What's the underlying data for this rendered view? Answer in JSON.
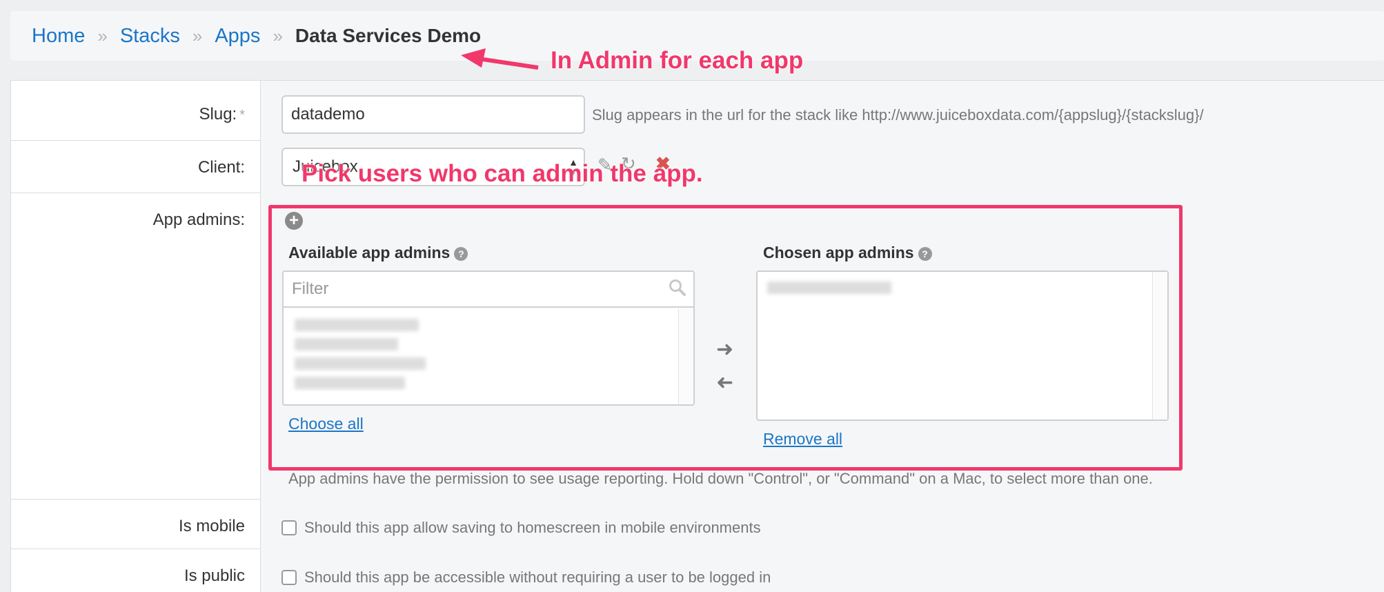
{
  "breadcrumb": {
    "items": [
      "Home",
      "Stacks",
      "Apps"
    ],
    "separator": "»",
    "current": "Data Services Demo"
  },
  "annotations": {
    "admin_note": "In Admin for each app",
    "pick_note": "Pick users who can admin the app."
  },
  "form": {
    "slug": {
      "label": "Slug:",
      "required_mark": "*",
      "value": "datademo",
      "help": "Slug appears in the url for the stack like http://www.juiceboxdata.com/{appslug}/{stackslug}/"
    },
    "client": {
      "label": "Client:",
      "value": "Juicebox"
    },
    "app_admins": {
      "label": "App admins:",
      "available_title": "Available app admins",
      "filter_placeholder": "Filter",
      "choose_all": "Choose all",
      "chosen_title": "Chosen app admins",
      "remove_all": "Remove all",
      "help": "App admins have the permission to see usage reporting. Hold down \"Control\", or \"Command\" on a Mac, to select more than one."
    },
    "is_mobile": {
      "label": "Is mobile",
      "help": "Should this app allow saving to homescreen in mobile environments",
      "checked": false
    },
    "is_public": {
      "label": "Is public",
      "help": "Should this app be accessible without requiring a user to be logged in",
      "checked": false
    }
  },
  "icons": {
    "add": "plus-circle-icon",
    "help": "question-circle-icon",
    "search": "search-icon",
    "move_right": "arrow-right-icon",
    "move_left": "arrow-left-icon",
    "edit": "pencil-icon",
    "delete": "x-icon"
  },
  "colors": {
    "link": "#1a76c7",
    "annotation": "#f0386b"
  }
}
